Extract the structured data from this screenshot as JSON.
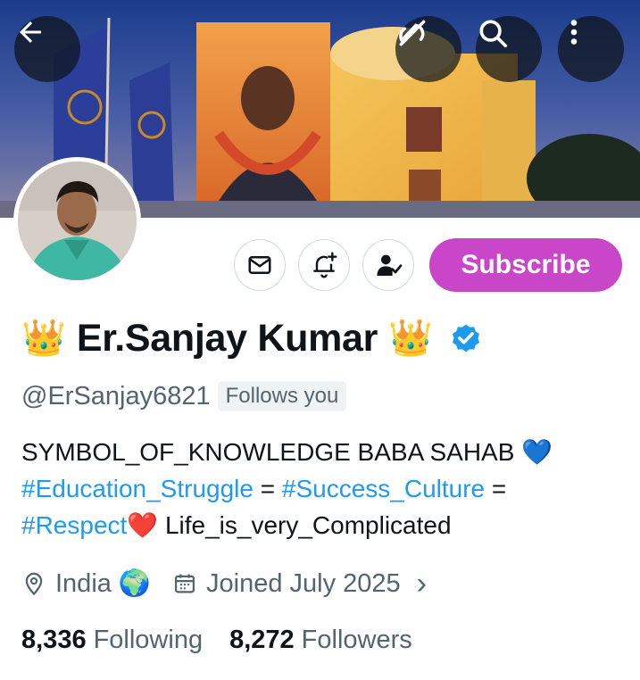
{
  "profile": {
    "crown_left": "👑",
    "display_name": "Er.Sanjay Kumar",
    "crown_right": "👑",
    "handle": "@ErSanjay6821",
    "follows_you": "Follows you"
  },
  "actions": {
    "subscribe_label": "Subscribe"
  },
  "bio": {
    "line1_text": "SYMBOL_OF_KNOWLEDGE BABA SAHAB ",
    "line1_emoji": "💙",
    "tag1": "#Education_Struggle",
    "eq1": " = ",
    "tag2": "#Success_Culture",
    "eq2": " =",
    "tag3": "#Respect",
    "heart": "❤️",
    "tail": " Life_is_very_Complicated"
  },
  "meta": {
    "location": "India",
    "location_emoji": "🌍",
    "joined": "Joined July 2025",
    "chevron": "›"
  },
  "counts": {
    "following_num": "8,336",
    "following_label": "Following",
    "followers_num": "8,272",
    "followers_label": "Followers"
  },
  "icons": [
    "back-arrow-icon",
    "grok-icon",
    "search-icon",
    "more-icon",
    "message-icon",
    "notification-add-icon",
    "following-icon",
    "verified-icon",
    "location-icon",
    "calendar-icon"
  ],
  "colors": {
    "subscribe_bg": "#c946c9",
    "hashtag": "#1d9bf0",
    "verified": "#1d9bf0",
    "secondary_text": "#536471"
  }
}
